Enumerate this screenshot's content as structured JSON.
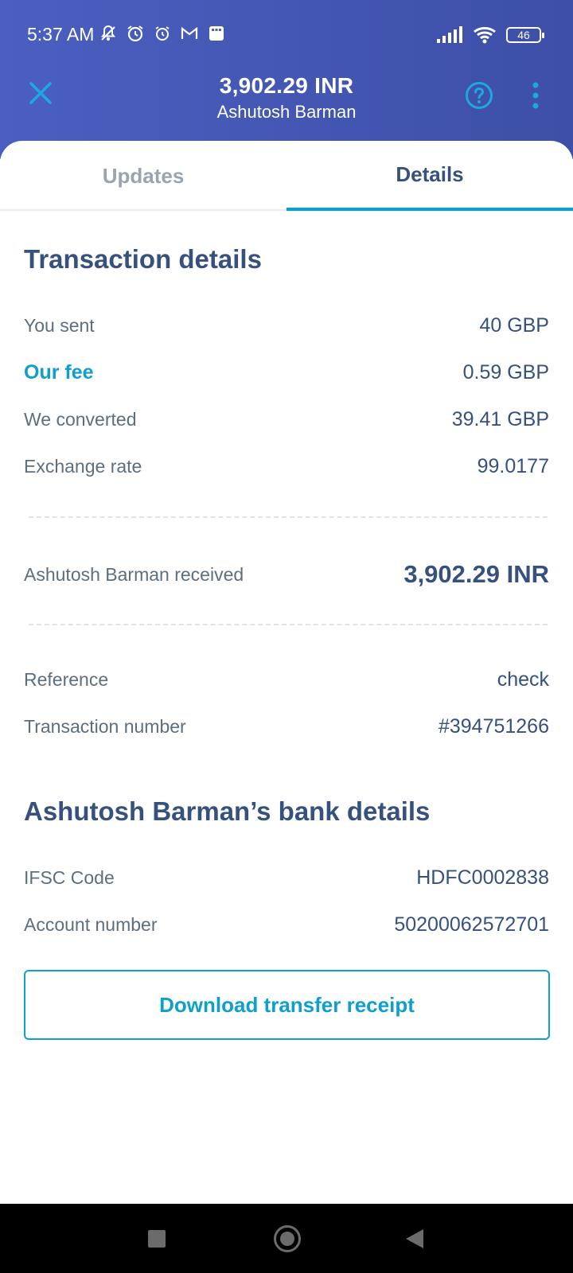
{
  "status_bar": {
    "time": "5:37 AM",
    "battery": "46",
    "left_icons": [
      "muted-notifications-icon",
      "alarm-icon",
      "clock-icon",
      "gmail-icon",
      "app-icon"
    ],
    "right_icons": [
      "signal-icon",
      "wifi-icon",
      "battery-icon"
    ]
  },
  "header": {
    "amount": "3,902.29 INR",
    "recipient": "Ashutosh Barman",
    "icons": [
      "close-icon",
      "help-icon",
      "more-vertical-icon"
    ]
  },
  "tabs": [
    {
      "label": "Updates",
      "active": false
    },
    {
      "label": "Details",
      "active": true
    }
  ],
  "transaction": {
    "title": "Transaction details",
    "you_sent": {
      "label": "You sent",
      "value": "40 GBP"
    },
    "our_fee": {
      "label": "Our fee",
      "value": "0.59 GBP"
    },
    "we_converted": {
      "label": "We converted",
      "value": "39.41 GBP"
    },
    "exchange_rate": {
      "label": "Exchange rate",
      "value": "99.0177"
    },
    "received": {
      "label": "Ashutosh Barman received",
      "value": "3,902.29 INR"
    },
    "reference": {
      "label": "Reference",
      "value": "check"
    },
    "transaction_number": {
      "label": "Transaction number",
      "value": "#394751266"
    }
  },
  "bank": {
    "title": "Ashutosh Barman’s bank details",
    "ifsc": {
      "label": "IFSC Code",
      "value": "HDFC0002838"
    },
    "account": {
      "label": "Account number",
      "value": "50200062572701"
    }
  },
  "actions": {
    "download_label": "Download transfer receipt"
  },
  "colors": {
    "header_bg": "#4a5fc1",
    "accent": "#0e9fcc",
    "text_primary": "#37517e",
    "text_secondary": "#5d6e7e"
  },
  "nav_bar": {
    "icons": [
      "recent-apps-icon",
      "home-icon",
      "back-icon"
    ]
  }
}
